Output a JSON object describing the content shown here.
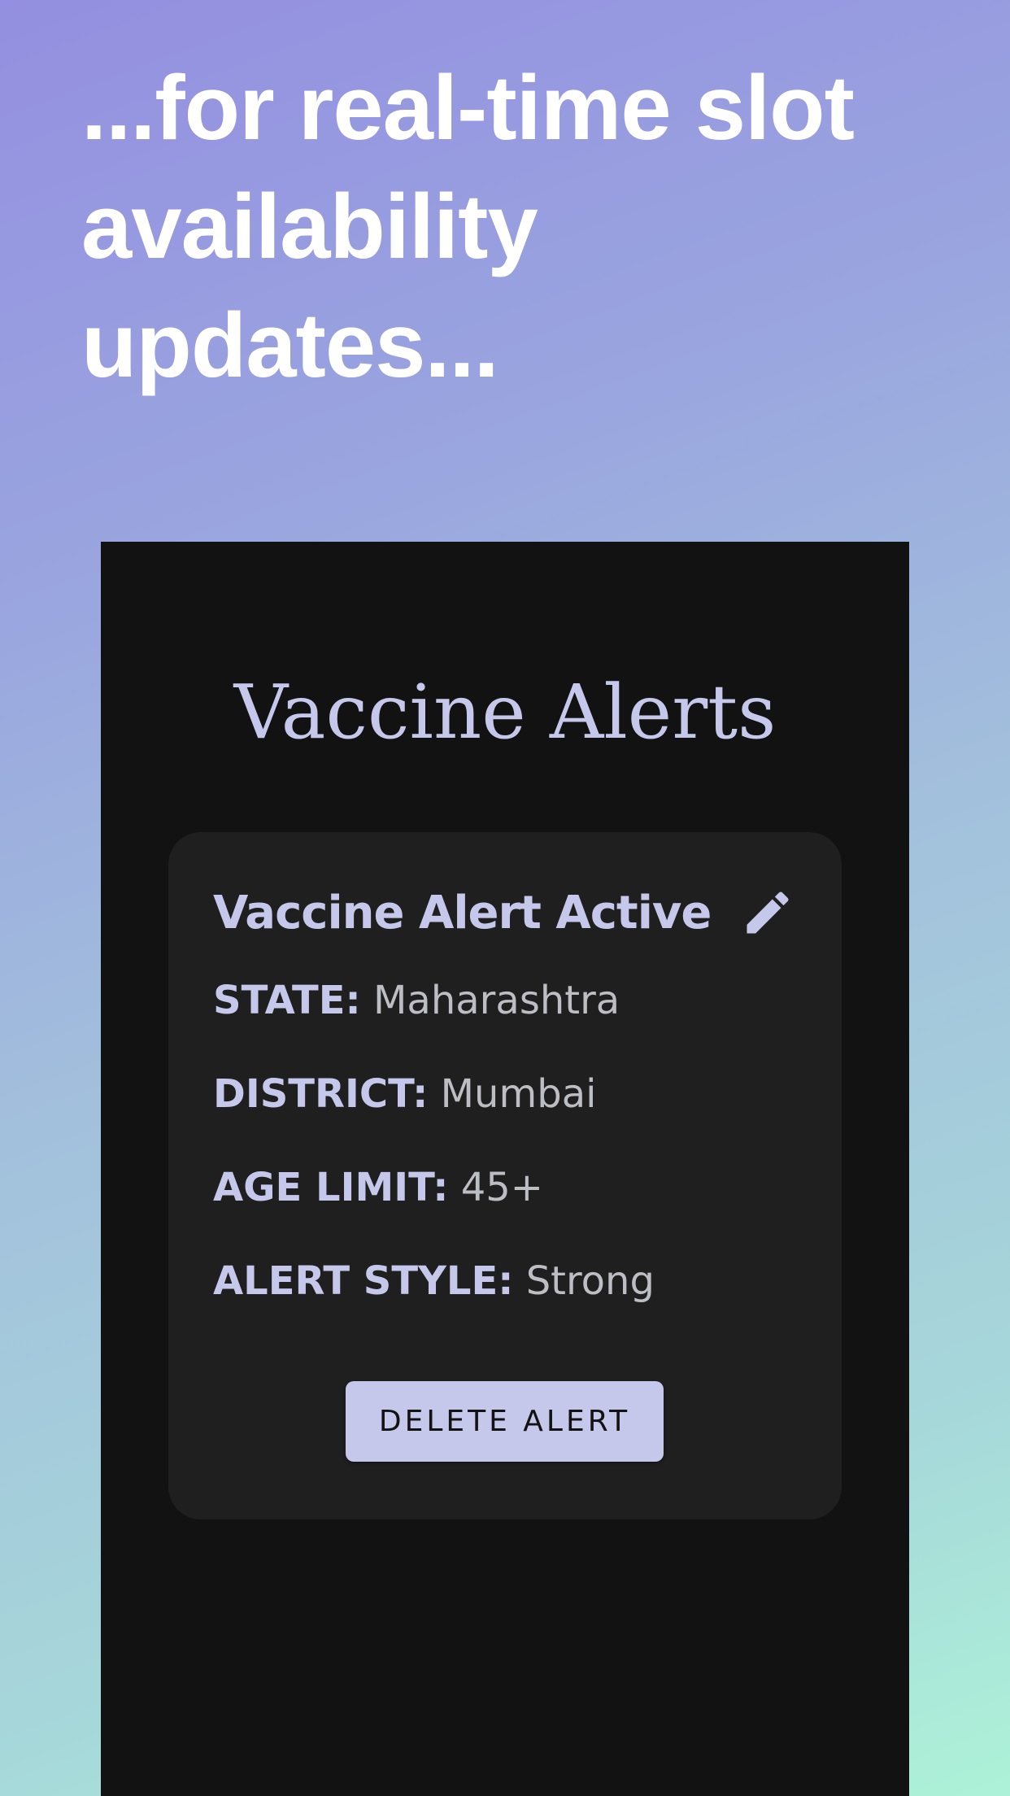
{
  "promo": {
    "headline": "...for real-time slot availability updates..."
  },
  "app": {
    "title": "Vaccine Alerts"
  },
  "alert_card": {
    "heading": "Vaccine Alert Active",
    "edit_icon": "pencil-edit-icon",
    "state": {
      "label": "STATE:",
      "value": "Maharashtra"
    },
    "district": {
      "label": "DISTRICT:",
      "value": "Mumbai"
    },
    "age_limit": {
      "label": "AGE LIMIT:",
      "value": "45+"
    },
    "alert_style": {
      "label": "ALERT STYLE:",
      "value": "Strong"
    },
    "delete_button_label": "DELETE ALERT"
  },
  "colors": {
    "accent": "#c5c8ea",
    "screen_background": "#121212",
    "card_background": "#1f1f1f",
    "value_text": "#bdbdc4"
  }
}
